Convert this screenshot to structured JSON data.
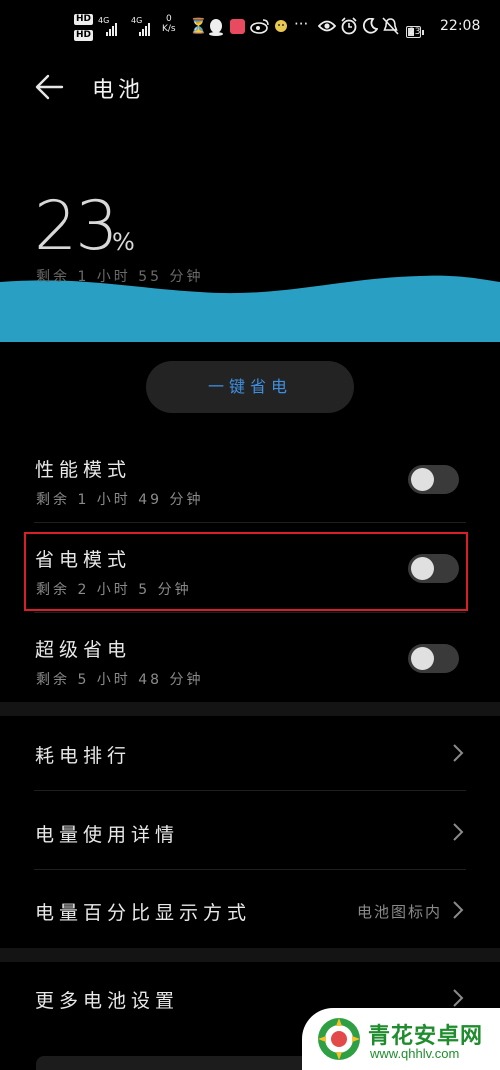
{
  "status_bar": {
    "hd1": "HD",
    "hd2": "HD",
    "net1": "4G",
    "net2": "4G",
    "speed_value": "0",
    "speed_unit": "K/s",
    "battery_level": "23",
    "time": "22:08",
    "icons": [
      "hourglass-icon",
      "qq-icon",
      "app-icon",
      "weibo-icon",
      "emoji-icon",
      "more-icon",
      "eye-icon",
      "alarm-icon",
      "moon-icon",
      "bell-off-icon"
    ]
  },
  "header": {
    "title": "电池"
  },
  "battery": {
    "percent": "23",
    "percent_sign": "%",
    "remaining": "剩余 1 小时 55 分钟"
  },
  "one_key_button": "一键省电",
  "modes": [
    {
      "label": "性能模式",
      "sub": "剩余 1 小时 49 分钟",
      "on": false
    },
    {
      "label": "省电模式",
      "sub": "剩余 2 小时 5 分钟",
      "on": false
    },
    {
      "label": "超级省电",
      "sub": "剩余 5 小时 48 分钟",
      "on": false
    }
  ],
  "nav": [
    {
      "label": "耗电排行",
      "value": ""
    },
    {
      "label": "电量使用详情",
      "value": ""
    },
    {
      "label": "电量百分比显示方式",
      "value": "电池图标内"
    },
    {
      "label": "更多电池设置",
      "value": ""
    }
  ],
  "watermark": {
    "name": "青花安卓网",
    "url": "www.qhhlv.com"
  },
  "colors": {
    "accent": "#3f8fe0",
    "wave": "#2a9fc4",
    "highlight": "#d61f26",
    "brand": "#1f8d2e"
  }
}
